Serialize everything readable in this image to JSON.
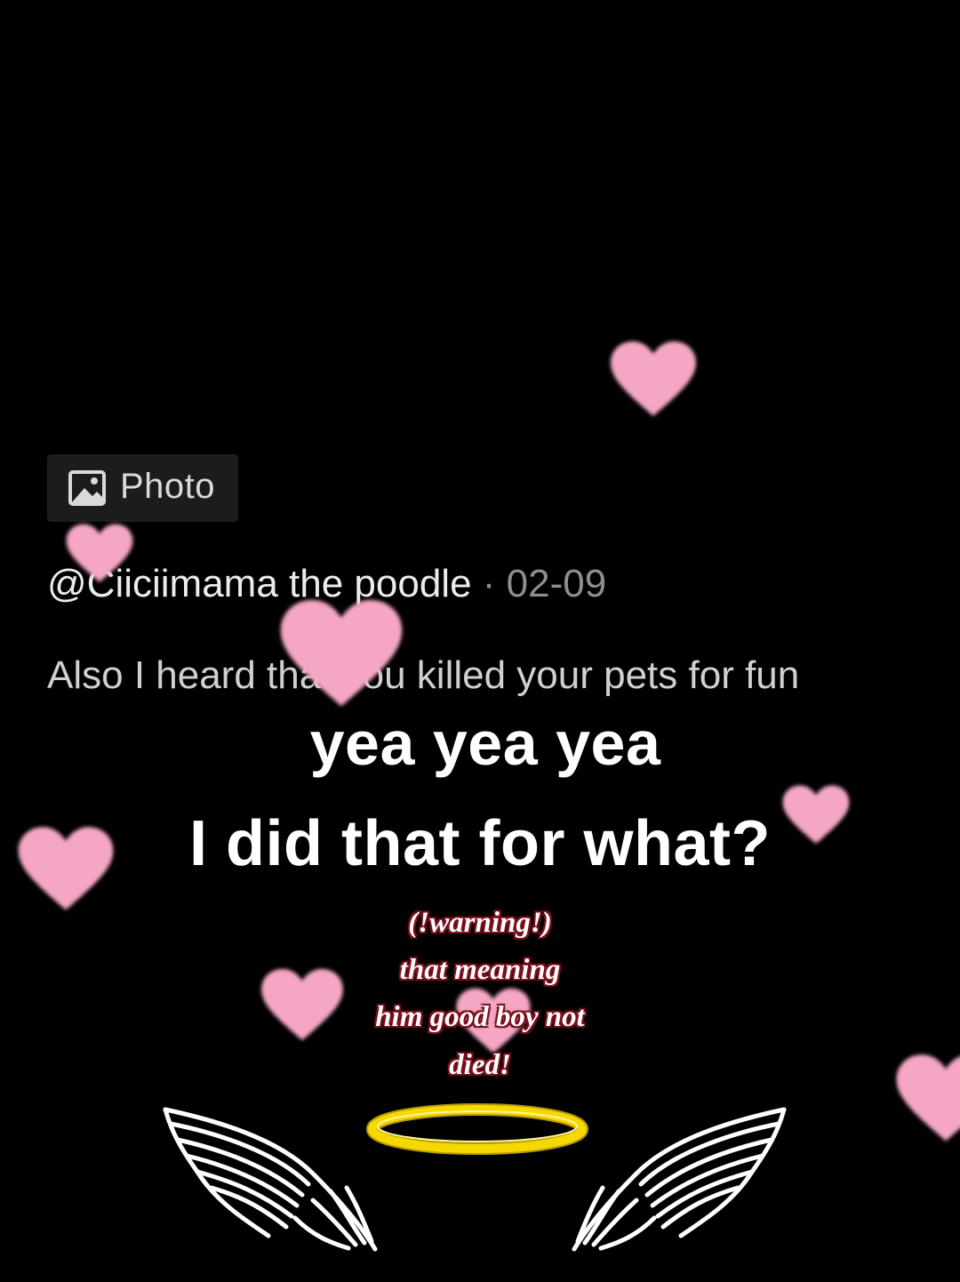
{
  "photo_chip": {
    "icon": "image-icon",
    "label": "Photo"
  },
  "comment": {
    "author": "@Ciiciimama the poodle",
    "separator": "·",
    "date": "02-09",
    "text": "Also I heard that you killed your pets for fun"
  },
  "caption": {
    "line1": "yea yea yea",
    "line2": "I did that for what?"
  },
  "note": {
    "line1": "(!warning!)",
    "line2": "that meaning",
    "line3": "him good boy not",
    "line4": "died!"
  },
  "decorations": {
    "heart_color": "#f4a6c4",
    "halo_color": "#f5d800",
    "wing_color": "#ffffff",
    "icons": [
      "heart-icon",
      "wing-icon",
      "halo-icon"
    ]
  }
}
